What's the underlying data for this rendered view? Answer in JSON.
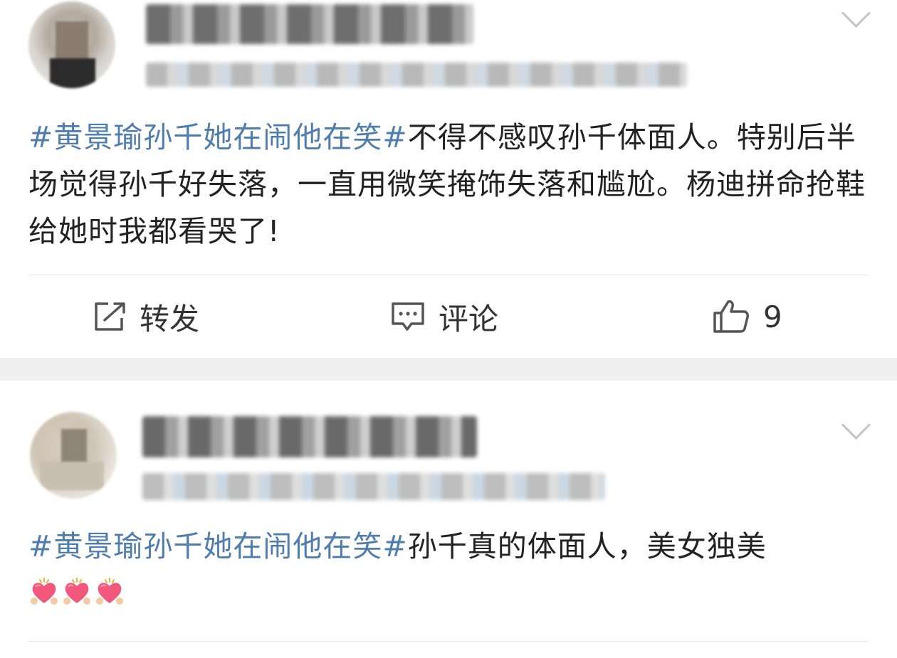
{
  "posts": [
    {
      "hashtag": "#黄景瑜孙千她在闹他在笑#",
      "body": "不得不感叹孙千体面人。特别后半场觉得孙千好失落，一直用微笑掩饰失落和尴尬。杨迪拼命抢鞋给她时我都看哭了!",
      "actions": {
        "repost_label": "转发",
        "comment_label": "评论",
        "like_count": "9"
      }
    },
    {
      "hashtag": "#黄景瑜孙千她在闹他在笑#",
      "body": "孙千真的体面人，美女独美",
      "emojis": [
        "heart-hands-emoji",
        "heart-hands-emoji",
        "heart-hands-emoji"
      ]
    }
  ],
  "icons": {
    "repost": "repost-icon",
    "comment": "comment-icon",
    "like": "thumbs-up-icon",
    "more": "chevron-down-icon"
  },
  "colors": {
    "hashtag": "#507daf",
    "separator": "#efefef",
    "icon": "#555555"
  }
}
